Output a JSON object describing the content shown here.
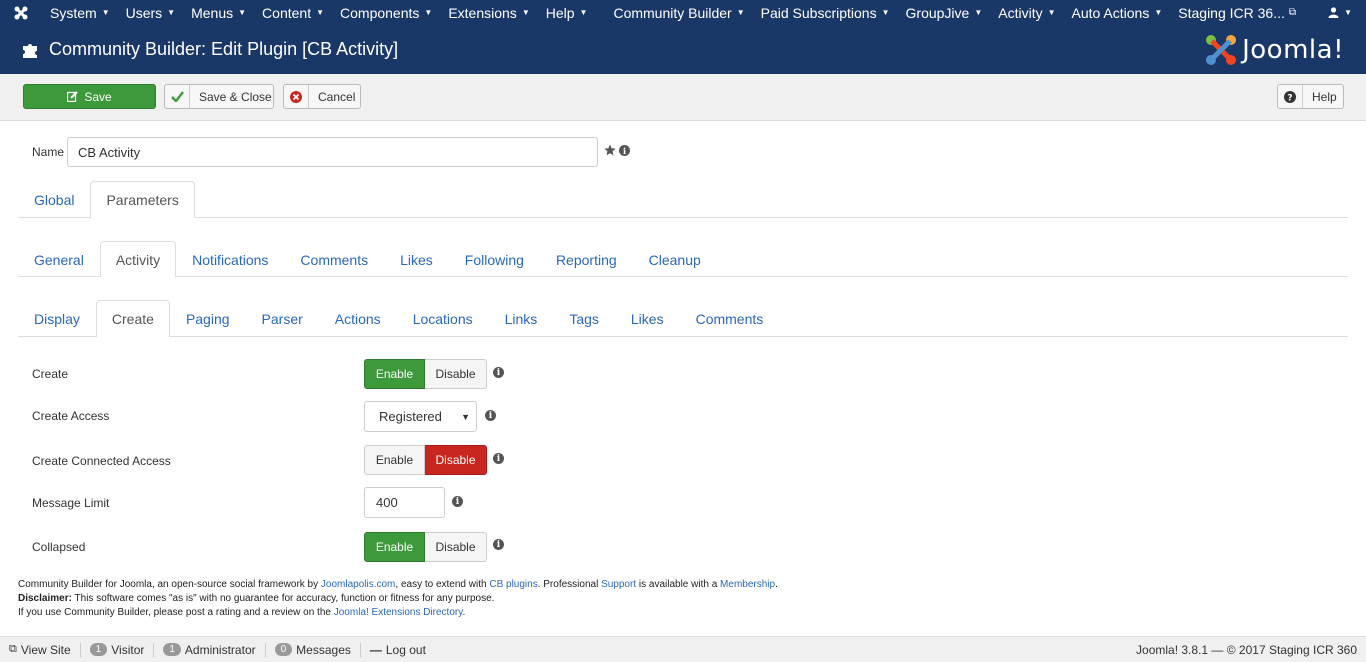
{
  "topnav": {
    "items": [
      "System",
      "Users",
      "Menus",
      "Content",
      "Components",
      "Extensions",
      "Help"
    ],
    "right_items": [
      "Community Builder",
      "Paid Subscriptions",
      "GroupJive",
      "Activity",
      "Auto Actions"
    ],
    "site_name": "Staging ICR 36..."
  },
  "header": {
    "title": "Community Builder: Edit Plugin [CB Activity]",
    "brand": "Joomla!"
  },
  "toolbar": {
    "save_label": "Save",
    "save_close_label": "Save & Close",
    "cancel_label": "Cancel",
    "help_label": "Help"
  },
  "form": {
    "name_label": "Name",
    "name_value": "CB Activity"
  },
  "tabs_level1": [
    "Global",
    "Parameters"
  ],
  "tabs_level2": [
    "General",
    "Activity",
    "Notifications",
    "Comments",
    "Likes",
    "Following",
    "Reporting",
    "Cleanup"
  ],
  "tabs_level3": [
    "Display",
    "Create",
    "Paging",
    "Parser",
    "Actions",
    "Locations",
    "Links",
    "Tags",
    "Likes",
    "Comments"
  ],
  "fields": {
    "create_label": "Create",
    "create_access_label": "Create Access",
    "create_access_value": "Registered",
    "create_connected_label": "Create Connected Access",
    "message_limit_label": "Message Limit",
    "message_limit_value": "400",
    "collapsed_label": "Collapsed",
    "enable": "Enable",
    "disable": "Disable"
  },
  "footer": {
    "line1_a": "Community Builder for Joomla, an open-source social framework by ",
    "link_joomlapolis": "Joomlapolis.com",
    "line1_b": ", easy to extend with ",
    "link_cbplugins": "CB plugins",
    "line1_c": ". Professional ",
    "link_support": "Support",
    "line1_d": " is available with a ",
    "link_membership": "Membership",
    "line1_e": ".",
    "disclaimer_bold": "Disclaimer:",
    "disclaimer_text": " This software comes \"as is\" with no guarantee for accuracy, function or fitness for any purpose.",
    "line3_a": "If you use Community Builder, please post a rating and a review on the ",
    "link_jed": "Joomla! Extensions Directory",
    "line3_b": "."
  },
  "statusbar": {
    "view_site": "View Site",
    "visitor_count": "1",
    "visitor_label": "Visitor",
    "admin_count": "1",
    "admin_label": "Administrator",
    "messages_count": "0",
    "messages_label": "Messages",
    "logout": "Log out",
    "version": "Joomla! 3.8.1 — © 2017 Staging ICR 360"
  },
  "colors": {
    "navy": "#1a3867",
    "green": "#3d9a3b",
    "red": "#c7271f",
    "link": "#2a69b8"
  }
}
